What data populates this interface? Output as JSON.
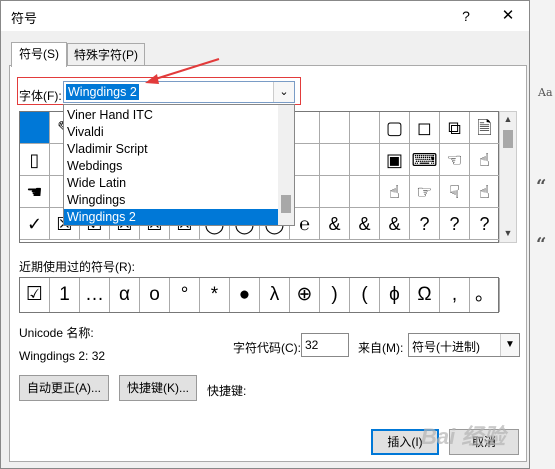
{
  "dialog": {
    "title": "符号",
    "help": "?",
    "close": "✕"
  },
  "tabs": [
    {
      "label": "符号(S)"
    },
    {
      "label": "特殊字符(P)"
    }
  ],
  "font": {
    "label": "字体(F):",
    "value": "Wingdings 2",
    "dropdown": "⌄"
  },
  "font_list": [
    {
      "label": "Viner Hand ITC"
    },
    {
      "label": "Vivaldi"
    },
    {
      "label": "Vladimir Script"
    },
    {
      "label": "Webdings"
    },
    {
      "label": "Wide Latin"
    },
    {
      "label": "Wingdings"
    },
    {
      "label": "Wingdings 2",
      "selected": true
    }
  ],
  "grid_rows": [
    [
      "",
      "✎",
      "",
      "",
      "",
      "",
      "",
      "",
      "",
      "",
      "",
      "",
      "▢",
      "◻",
      "⧉",
      "🗎",
      "▤",
      "▦",
      "▯",
      ""
    ],
    [
      "▯",
      "",
      "",
      "",
      "",
      "",
      "",
      "",
      "",
      "",
      "",
      "",
      "▣",
      "⌨",
      "☜",
      "☝",
      "☟",
      "☚",
      "☛",
      ""
    ],
    [
      "☚",
      "",
      "",
      "",
      "",
      "",
      "",
      "",
      "",
      "",
      "",
      "",
      "☝",
      "☞",
      "☟",
      "☝",
      "✋",
      "✕",
      "",
      ""
    ],
    [
      "✓",
      "☒",
      "☑",
      "☒",
      "☒",
      "☒",
      "◯",
      "◯",
      "◯",
      "℮",
      "&",
      "&",
      "&",
      "?",
      "?",
      "?",
      "",
      "",
      "",
      ""
    ]
  ],
  "recent_label": "近期使用过的符号(R):",
  "recent_symbols": [
    "☑",
    "1",
    "…",
    "α",
    "ο",
    "°",
    "*",
    "●",
    "λ",
    "⊕",
    ")",
    "(",
    "ϕ",
    "Ω",
    ",",
    "。"
  ],
  "unicode_label": "Unicode 名称:",
  "unicode_value": "Wingdings 2: 32",
  "code_label": "字符代码(C):",
  "code_value": "32",
  "from_label": "来自(M):",
  "from_value": "符号(十进制)",
  "buttons": {
    "autocorrect": "自动更正(A)...",
    "shortcut": "快捷键(K)...",
    "insert": "插入(I)",
    "cancel": "取消"
  },
  "shortcut_label": "快捷键:",
  "accent_color": "#0078d7",
  "highlight_color": "#e23b3b",
  "watermark": "Bai 经验"
}
